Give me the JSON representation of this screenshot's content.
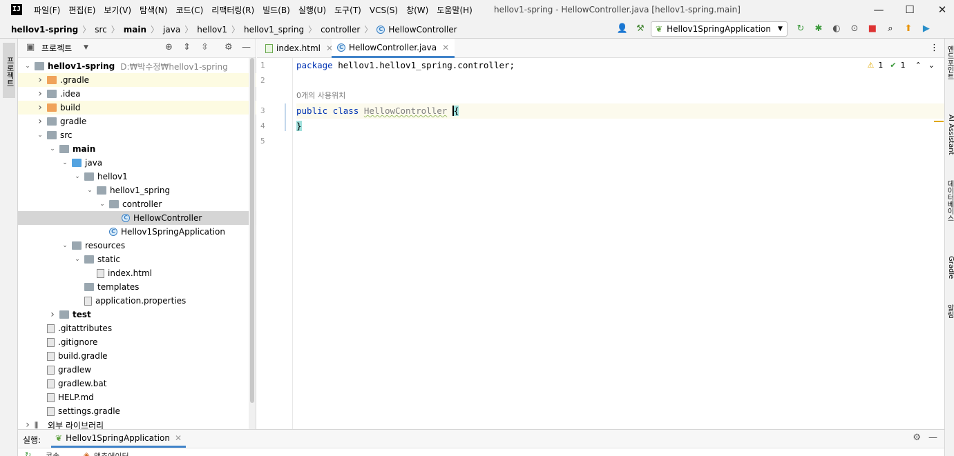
{
  "window": {
    "app_icon": "IJ",
    "title": "hellov1-spring - HellowController.java [hellov1-spring.main]",
    "menu": [
      "파일(F)",
      "편집(E)",
      "보기(V)",
      "탐색(N)",
      "코드(C)",
      "리팩터링(R)",
      "빌드(B)",
      "실행(U)",
      "도구(T)",
      "VCS(S)",
      "창(W)",
      "도움말(H)"
    ],
    "controls": {
      "minimize": "—",
      "maximize": "☐",
      "close": "✕"
    }
  },
  "breadcrumb": [
    "hellov1-spring",
    "src",
    "main",
    "java",
    "hellov1",
    "hellov1_spring",
    "controller",
    "HellowController"
  ],
  "toolbar": {
    "run_config": "Hellov1SpringApplication",
    "icons": [
      "user-icon",
      "build-hammer-icon",
      "run-config-icon",
      "rerun-icon",
      "debug-icon",
      "coverage-icon",
      "profile-icon",
      "stop-icon",
      "search-icon",
      "update-icon",
      "plugin-icon"
    ]
  },
  "left_strip": {
    "tab": "프로젝트"
  },
  "project": {
    "title": "프로젝트",
    "tree": [
      {
        "label": "hellov1-spring",
        "path": "D:₩박수정₩hellov1-spring",
        "depth": 0,
        "arrow": "down",
        "icon": "folder",
        "bold": true
      },
      {
        "label": ".gradle",
        "depth": 1,
        "arrow": "right",
        "icon": "folder-orange",
        "hl": true
      },
      {
        "label": ".idea",
        "depth": 1,
        "arrow": "right",
        "icon": "folder"
      },
      {
        "label": "build",
        "depth": 1,
        "arrow": "right",
        "icon": "folder-orange",
        "hl": true
      },
      {
        "label": "gradle",
        "depth": 1,
        "arrow": "right",
        "icon": "folder"
      },
      {
        "label": "src",
        "depth": 1,
        "arrow": "down",
        "icon": "folder"
      },
      {
        "label": "main",
        "depth": 2,
        "arrow": "down",
        "icon": "folder",
        "bold": true
      },
      {
        "label": "java",
        "depth": 3,
        "arrow": "down",
        "icon": "folder-blue"
      },
      {
        "label": "hellov1",
        "depth": 4,
        "arrow": "down",
        "icon": "folder"
      },
      {
        "label": "hellov1_spring",
        "depth": 5,
        "arrow": "down",
        "icon": "folder"
      },
      {
        "label": "controller",
        "depth": 6,
        "arrow": "down",
        "icon": "folder"
      },
      {
        "label": "HellowController",
        "depth": 7,
        "arrow": "",
        "icon": "class",
        "sel": true
      },
      {
        "label": "Hellov1SpringApplication",
        "depth": 6,
        "arrow": "",
        "icon": "class"
      },
      {
        "label": "resources",
        "depth": 3,
        "arrow": "down",
        "icon": "folder"
      },
      {
        "label": "static",
        "depth": 4,
        "arrow": "down",
        "icon": "folder"
      },
      {
        "label": "index.html",
        "depth": 5,
        "arrow": "",
        "icon": "file"
      },
      {
        "label": "templates",
        "depth": 4,
        "arrow": "",
        "icon": "folder"
      },
      {
        "label": "application.properties",
        "depth": 4,
        "arrow": "",
        "icon": "file"
      },
      {
        "label": "test",
        "depth": 2,
        "arrow": "right",
        "icon": "folder",
        "bold": true
      },
      {
        "label": ".gitattributes",
        "depth": 1,
        "arrow": "",
        "icon": "file"
      },
      {
        "label": ".gitignore",
        "depth": 1,
        "arrow": "",
        "icon": "file"
      },
      {
        "label": "build.gradle",
        "depth": 1,
        "arrow": "",
        "icon": "file"
      },
      {
        "label": "gradlew",
        "depth": 1,
        "arrow": "",
        "icon": "file"
      },
      {
        "label": "gradlew.bat",
        "depth": 1,
        "arrow": "",
        "icon": "file"
      },
      {
        "label": "HELP.md",
        "depth": 1,
        "arrow": "",
        "icon": "file"
      },
      {
        "label": "settings.gradle",
        "depth": 1,
        "arrow": "",
        "icon": "file"
      },
      {
        "label": "외부 라이브러리",
        "depth": 0,
        "arrow": "right",
        "icon": "library"
      }
    ]
  },
  "editor": {
    "tabs": [
      {
        "label": "index.html",
        "close": "✕"
      },
      {
        "label": "HellowController.java",
        "close": "✕"
      }
    ],
    "line_numbers": [
      "1",
      "2",
      "3",
      "4",
      "5"
    ],
    "code": {
      "line1_kw": "package",
      "line1_rest": " hellov1.hellov1_spring.controller;",
      "usage_hint": "0개의 사용위치",
      "line3_kw": "public class",
      "line3_class": "HellowController",
      "line3_brace": "{",
      "line4": "}"
    },
    "inspections": {
      "warnings": "1",
      "ok": "1"
    }
  },
  "right_strip": [
    "엔드포인트",
    "AI Assistant",
    "데이터베이스",
    "Gradle",
    "알림"
  ],
  "run_panel": {
    "label": "실행:",
    "tab": "Hellov1SpringApplication",
    "close": "✕"
  },
  "bottom_tabs": [
    "콘솔",
    "액추에이터"
  ]
}
